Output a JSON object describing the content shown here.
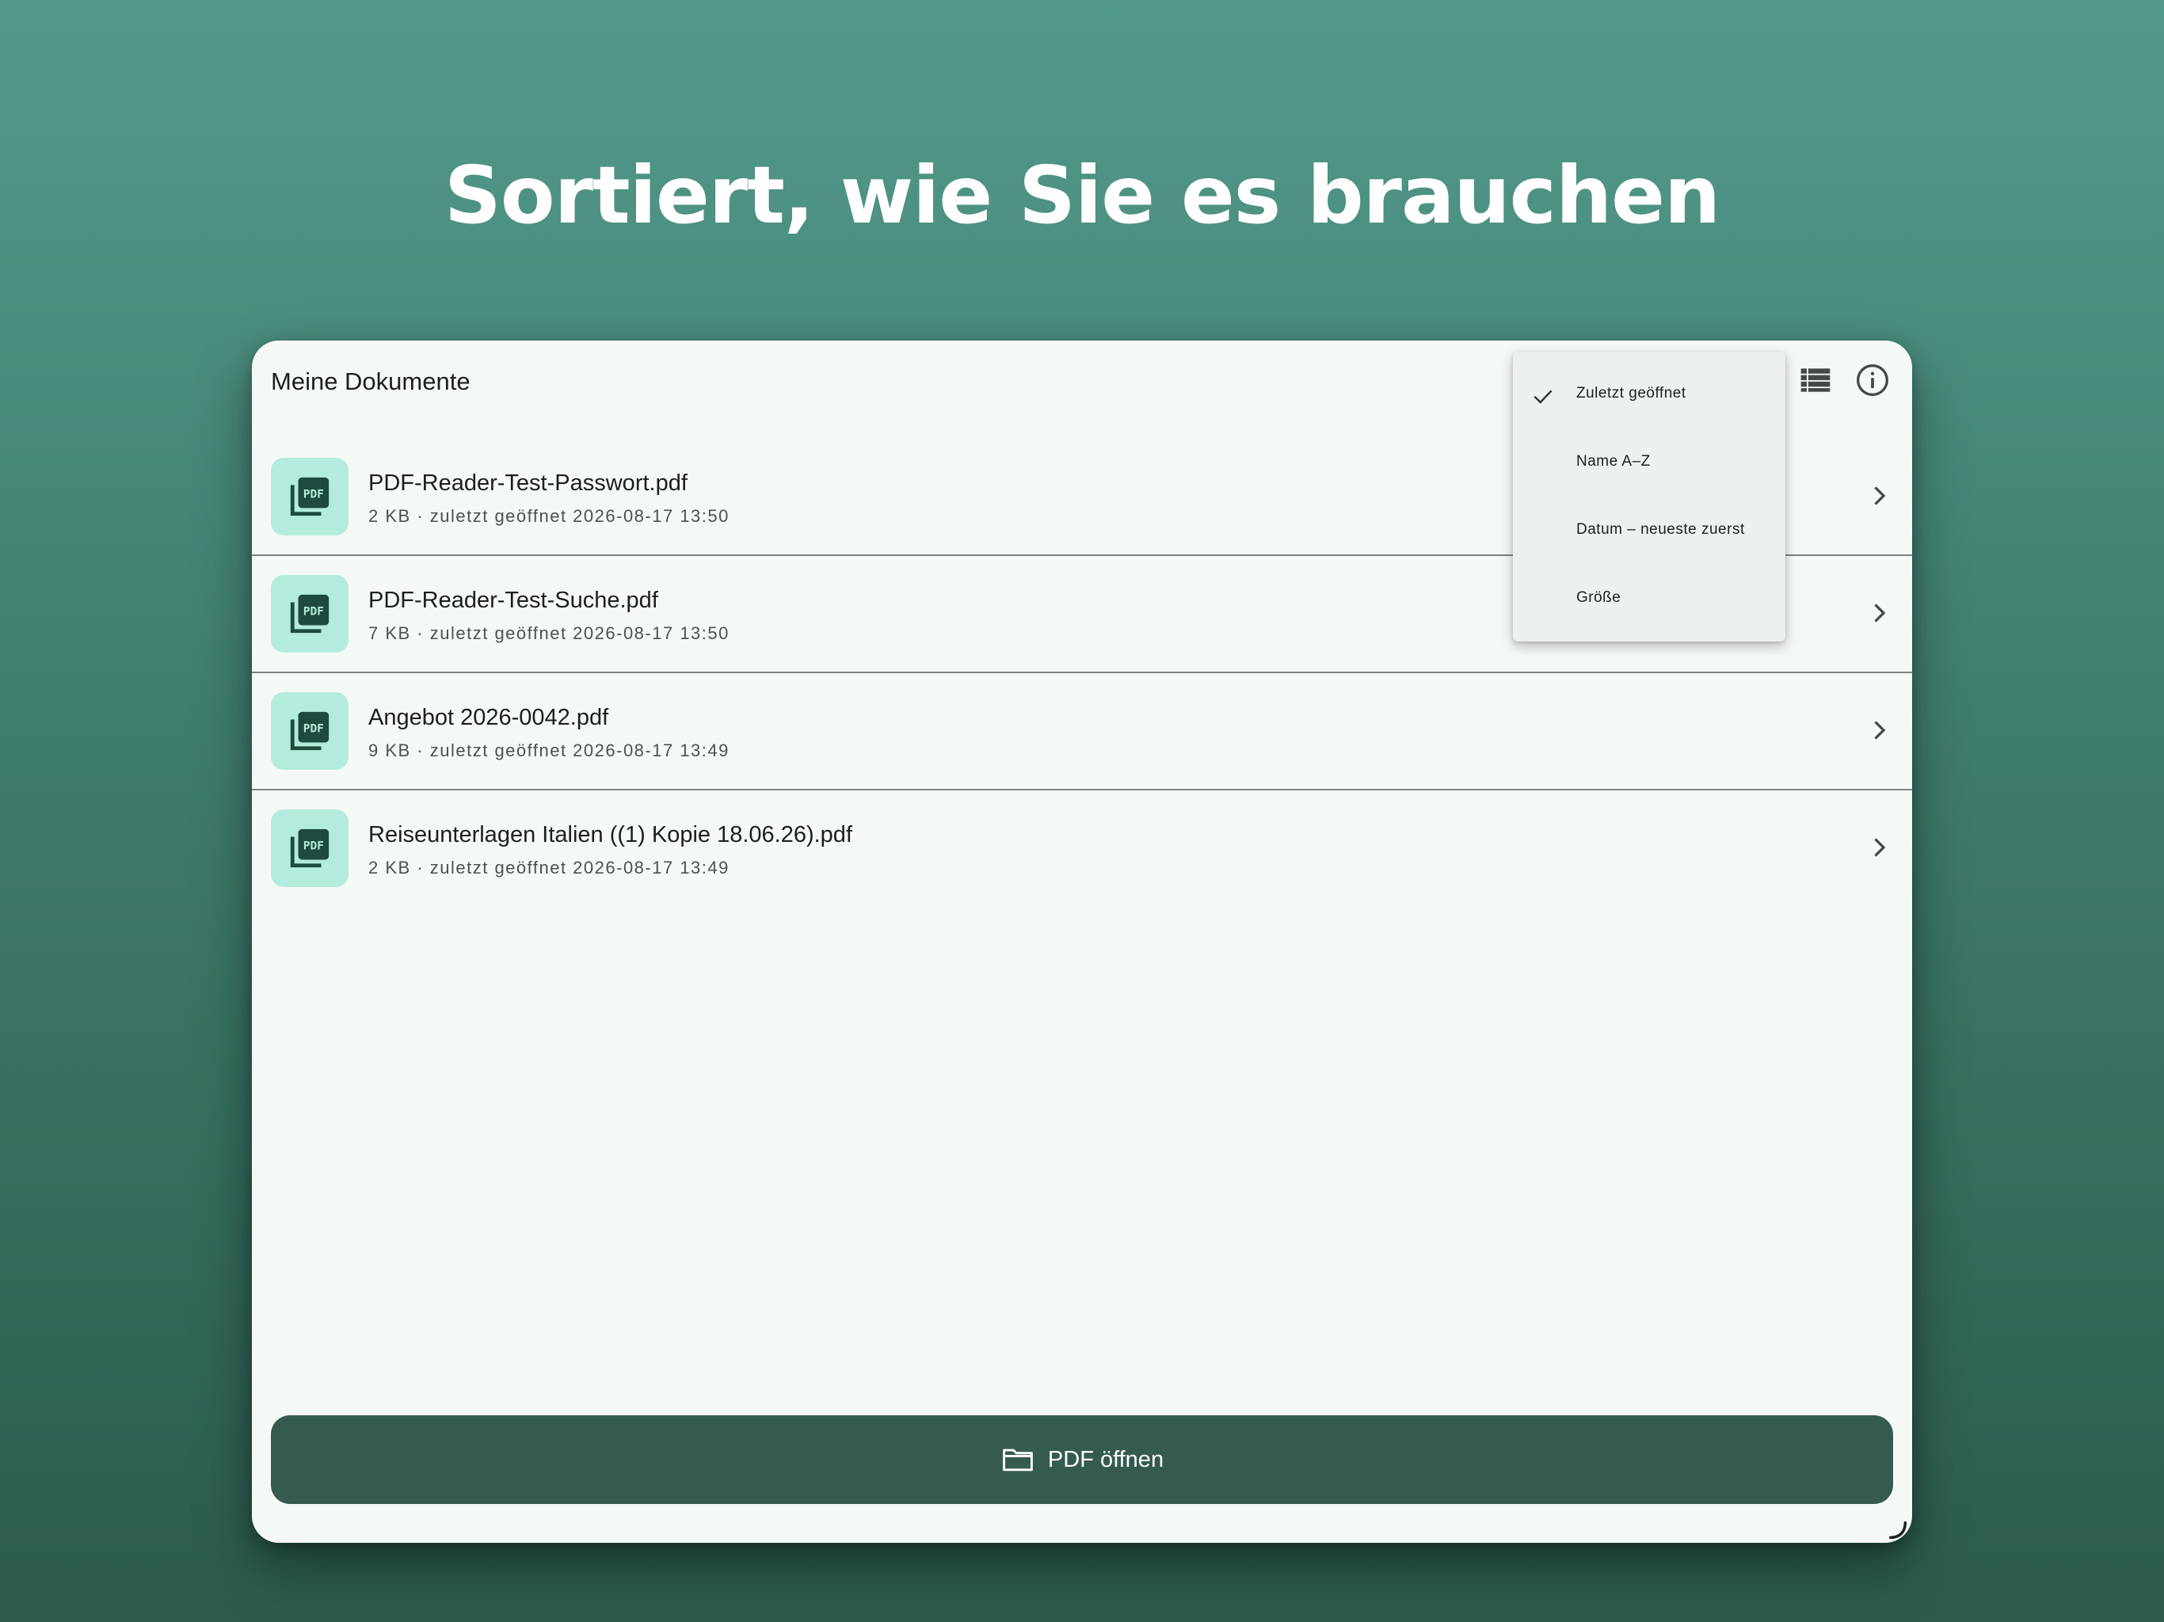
{
  "headline": "Sortiert, wie Sie es brauchen",
  "app": {
    "title": "Meine Dokumente"
  },
  "documents": [
    {
      "name": "PDF-Reader-Test-Passwort.pdf",
      "meta": "2 KB · zuletzt geöffnet 2026-08-17 13:50",
      "thumb_label": "PDF"
    },
    {
      "name": "PDF-Reader-Test-Suche.pdf",
      "meta": "7 KB · zuletzt geöffnet 2026-08-17 13:50",
      "thumb_label": "PDF"
    },
    {
      "name": "Angebot 2026-0042.pdf",
      "meta": "9 KB · zuletzt geöffnet 2026-08-17 13:49",
      "thumb_label": "PDF"
    },
    {
      "name": "Reiseunterlagen Italien ((1) Kopie 18.06.26).pdf",
      "meta": "2 KB · zuletzt geöffnet 2026-08-17 13:49",
      "thumb_label": "PDF"
    }
  ],
  "sort_menu": {
    "items": [
      {
        "label": "Zuletzt geöffnet",
        "selected": true
      },
      {
        "label": "Name A–Z",
        "selected": false
      },
      {
        "label": "Datum – neueste zuerst",
        "selected": false
      },
      {
        "label": "Größe",
        "selected": false
      }
    ]
  },
  "open_button": {
    "label": "PDF öffnen"
  },
  "icons": {
    "view": "view-list-icon",
    "info": "info-circle-icon",
    "thumb": "pdf-stack-icon",
    "chevron": "chevron-right-icon",
    "check": "check-icon",
    "folder": "folder-icon"
  },
  "colors": {
    "accent": "#355b51",
    "thumb_bg": "#b3ecdc",
    "surface": "#f5f9f6",
    "menu_bg": "#edf1ee"
  }
}
